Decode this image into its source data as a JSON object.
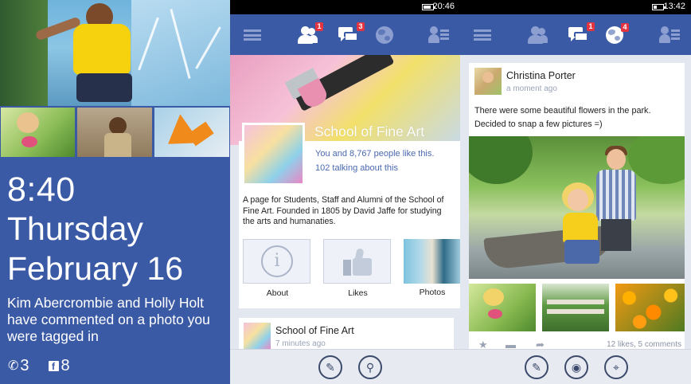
{
  "lock_screen": {
    "time": "8:40",
    "day": "Thursday",
    "date": "February 16",
    "notification": "Kim Abercrombie and Holly Holt have commented on a photo you were tagged in",
    "missed_calls": "3",
    "facebook_count": "8",
    "accent_color": "#3b5aa6"
  },
  "page_screen": {
    "status_clock": "20:46",
    "nav_badges": {
      "friends": "1",
      "messages": "3"
    },
    "page": {
      "name": "School of Fine Art",
      "likes": "You and 8,767 people like this.",
      "talking": "102 talking about this",
      "description": "A page for Students, Staff and Alumni of the School of Fine Art. Founded in 1805 by David Jaffe for studying the arts and humanaties."
    },
    "tiles": [
      "About",
      "Likes",
      "Photos"
    ],
    "post": {
      "author": "School of Fine Art",
      "time": "7 minutes ago"
    },
    "appbar": [
      "edit-icon",
      "pin-icon"
    ]
  },
  "status_screen": {
    "status_clock": "13:42",
    "nav_badges": {
      "messages": "1",
      "notifications": "4"
    },
    "post": {
      "author": "Christina Porter",
      "time": "a moment ago",
      "text_line1": "There were some beautiful flowers in the park.",
      "text_line2": "Decided to snap a few pictures =)",
      "counts": "12 likes, 5 comments"
    },
    "appbar": [
      "edit-icon",
      "camera-icon",
      "check-in-icon"
    ]
  },
  "colors": {
    "facebook_blue": "#3b5aa6",
    "badge_red": "#e3343f",
    "link_blue": "#4a68b1"
  }
}
